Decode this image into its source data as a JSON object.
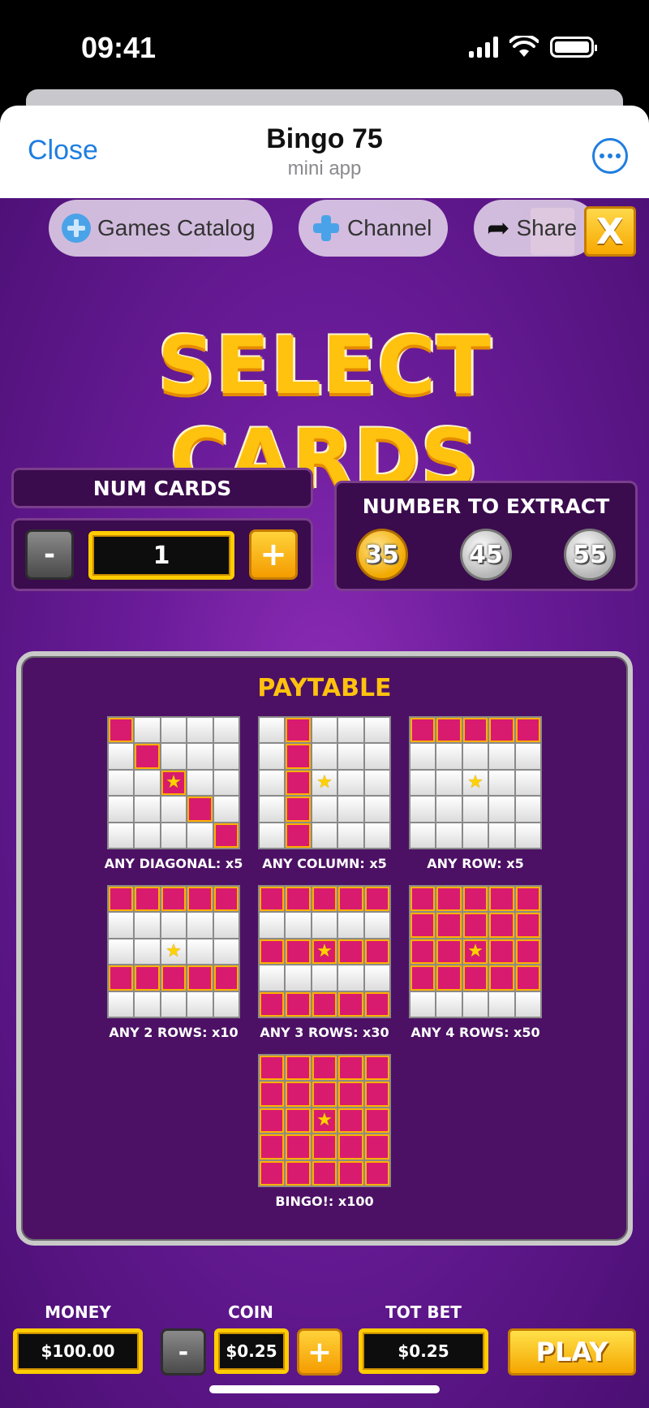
{
  "status_bar": {
    "time": "09:41"
  },
  "header": {
    "close_label": "Close",
    "title": "Bingo 75",
    "subtitle": "mini app"
  },
  "top_buttons": {
    "games_catalog": "Games Catalog",
    "channel": "Channel",
    "share": "Share",
    "close_x": "X"
  },
  "title": "SELECT CARDS",
  "num_cards": {
    "label": "NUM CARDS",
    "minus": "-",
    "value": "1",
    "plus": "+"
  },
  "extract": {
    "label": "NUMBER TO EXTRACT",
    "options": [
      "35",
      "45",
      "55"
    ],
    "selected": "35"
  },
  "paytable": {
    "title": "PAYTABLE",
    "patterns": [
      {
        "label": "ANY DIAGONAL: x5",
        "cells": [
          [
            0,
            0
          ],
          [
            1,
            1
          ],
          [
            2,
            2
          ],
          [
            3,
            3
          ],
          [
            4,
            4
          ]
        ]
      },
      {
        "label": "ANY COLUMN: x5",
        "cells": [
          [
            0,
            1
          ],
          [
            1,
            1
          ],
          [
            2,
            1
          ],
          [
            3,
            1
          ],
          [
            4,
            1
          ]
        ]
      },
      {
        "label": "ANY ROW: x5",
        "cells": [
          [
            0,
            0
          ],
          [
            0,
            1
          ],
          [
            0,
            2
          ],
          [
            0,
            3
          ],
          [
            0,
            4
          ]
        ]
      },
      {
        "label": "ANY 2 ROWS: x10",
        "rows": [
          0,
          3
        ]
      },
      {
        "label": "ANY 3 ROWS: x30",
        "rows": [
          0,
          2,
          4
        ]
      },
      {
        "label": "ANY 4 ROWS: x50",
        "rows": [
          0,
          1,
          2,
          3
        ]
      },
      {
        "label": "BINGO!: x100",
        "rows": [
          0,
          1,
          2,
          3,
          4
        ]
      }
    ]
  },
  "bottom": {
    "money_label": "MONEY",
    "money_value": "$100.00",
    "coin_label": "COIN",
    "coin_minus": "-",
    "coin_value": "$0.25",
    "coin_plus": "+",
    "totbet_label": "TOT BET",
    "totbet_value": "$0.25",
    "play_label": "PLAY"
  },
  "colors": {
    "bg_purple": "#6b1c9a",
    "gold": "#ffc20e",
    "pink_cell": "#d81b6f",
    "ios_blue": "#1f7ee0"
  },
  "icons": [
    "signal-icon",
    "wifi-icon",
    "battery-icon",
    "more-icon",
    "games-catalog-icon",
    "channel-icon",
    "share-icon",
    "star-icon"
  ]
}
